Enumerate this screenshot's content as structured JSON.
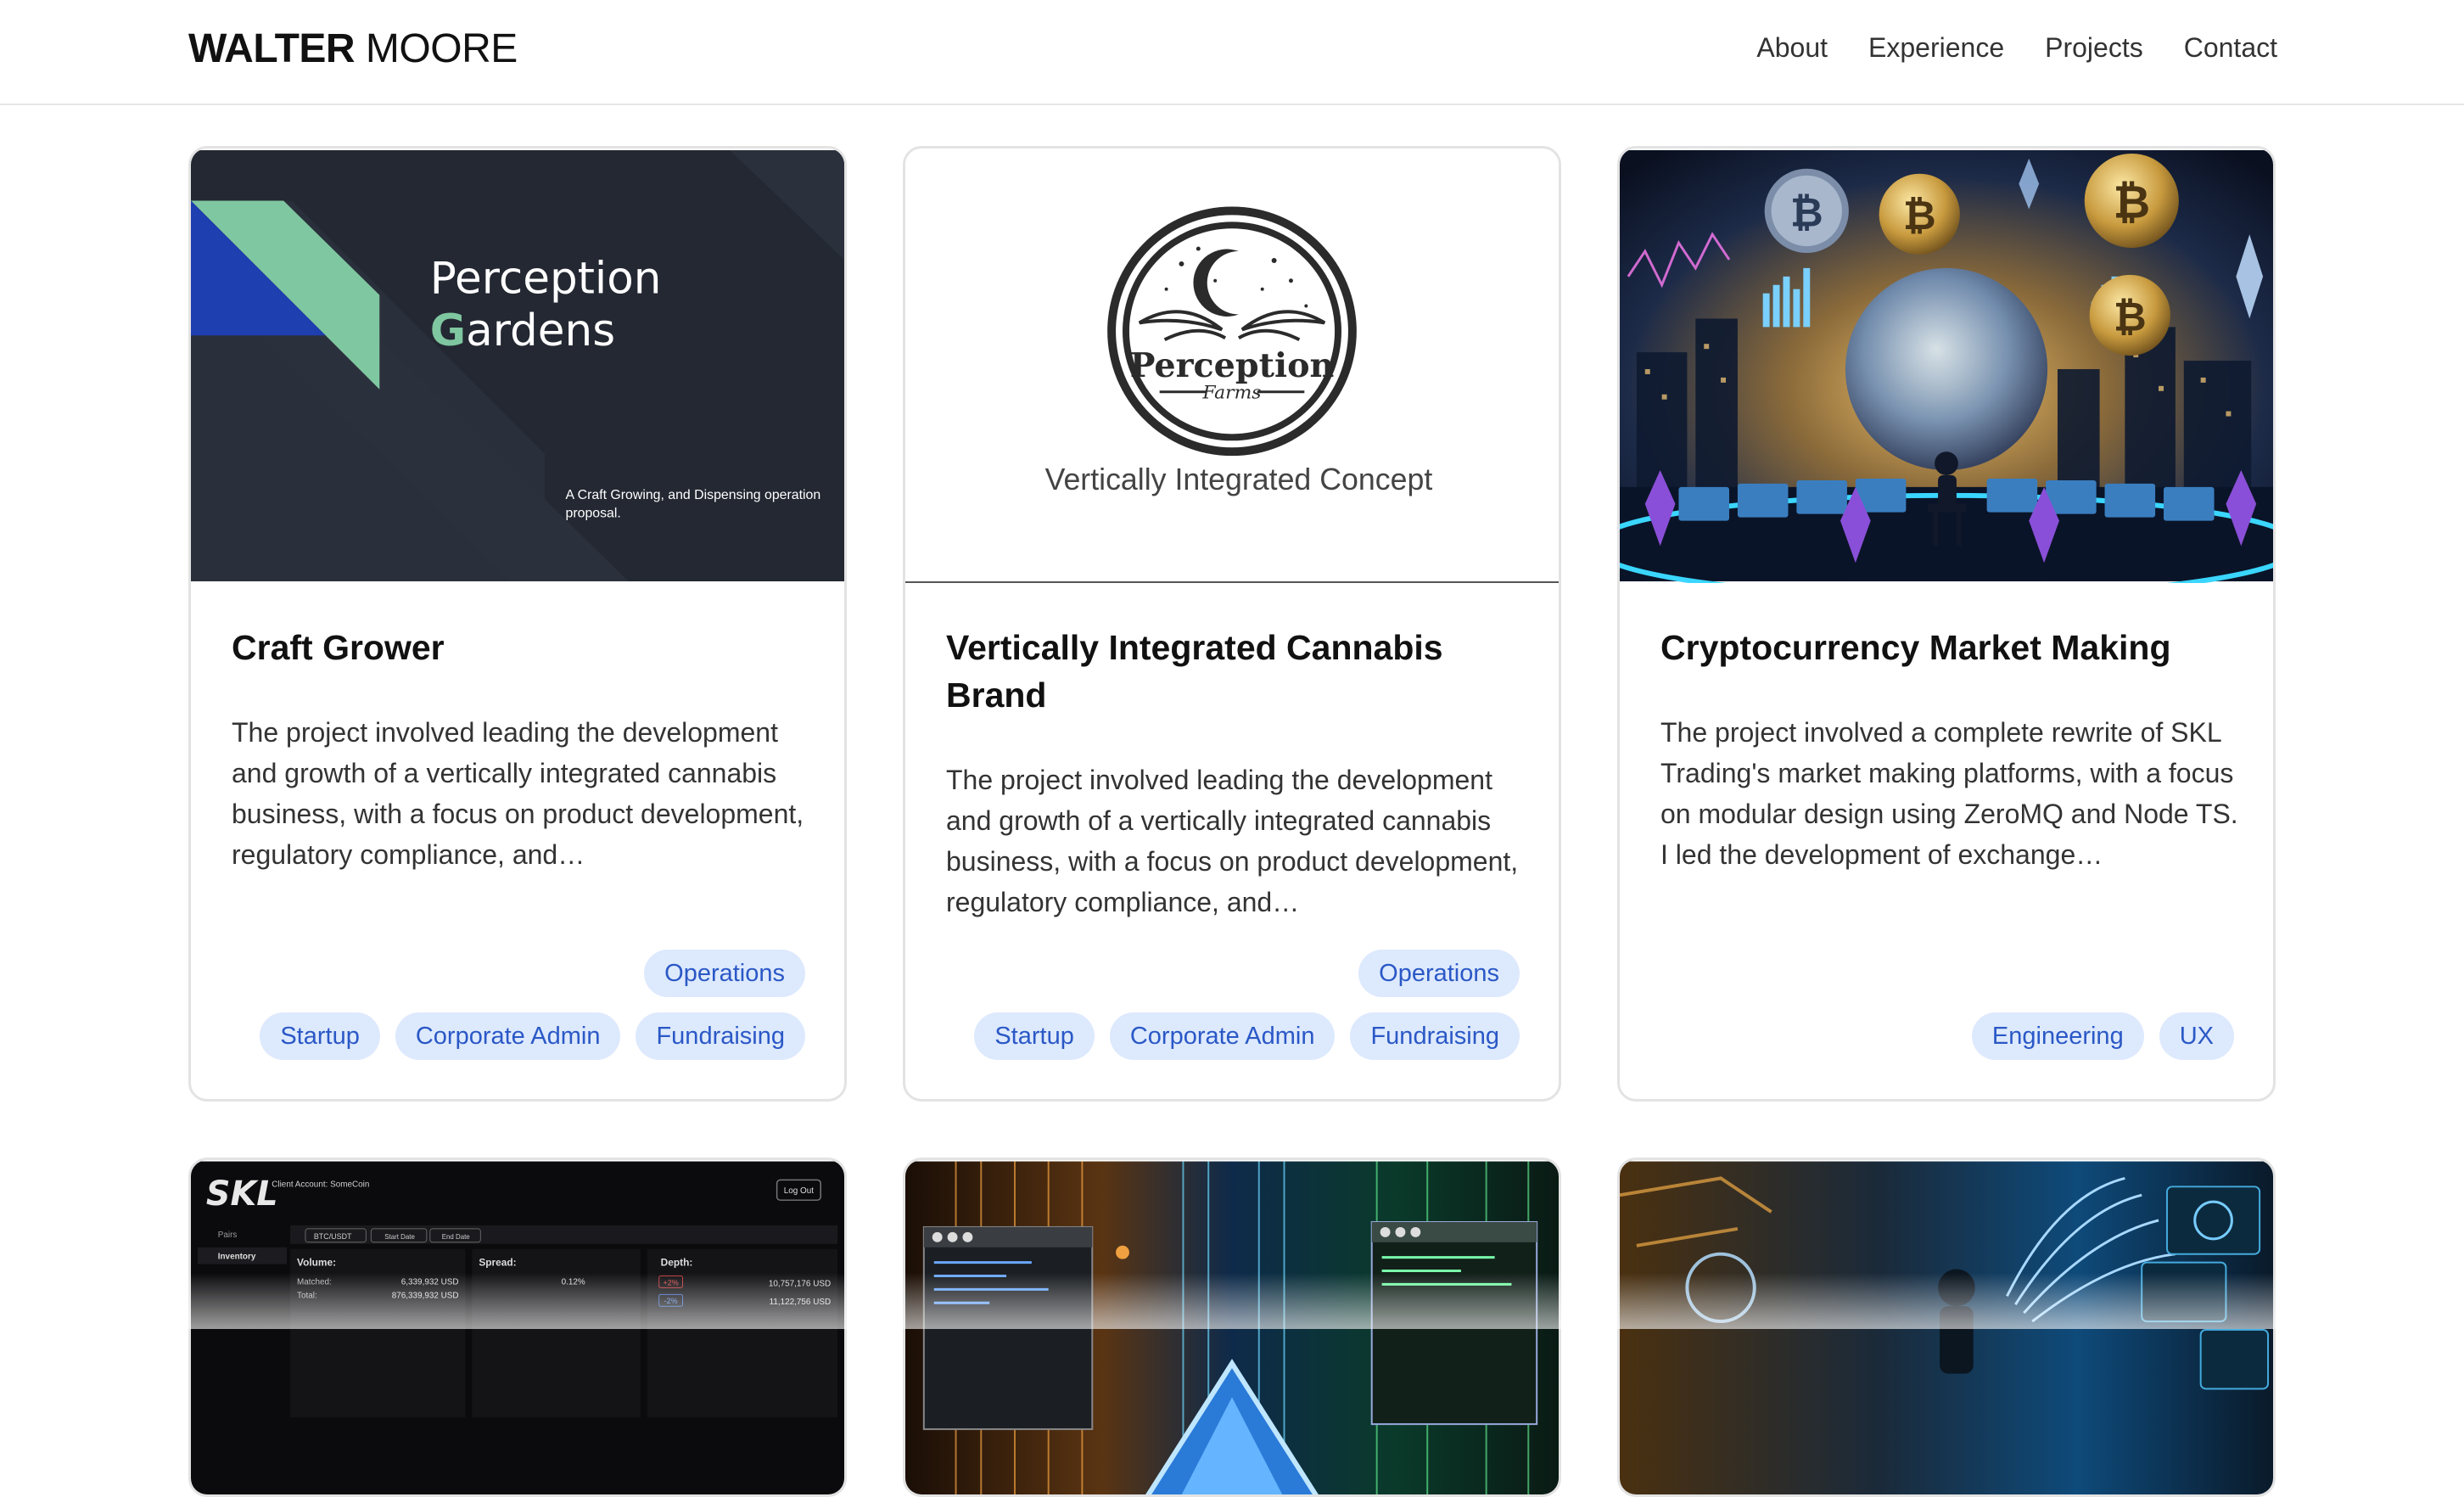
{
  "header": {
    "logo_first": "WALTER",
    "logo_last": "MOORE",
    "nav": [
      "About",
      "Experience",
      "Projects",
      "Contact"
    ]
  },
  "projects": [
    {
      "image": {
        "title_line1": "Perception",
        "title_line2_initial": "G",
        "title_line2_rest": "ardens",
        "caption_line1": "A Craft Growing, and Dispensing operation",
        "caption_line2": "proposal."
      },
      "title": "Craft Grower",
      "description": "The project involved leading the development and growth of a vertically integrated cannabis business, with a focus on product development, regulatory compliance, and…",
      "tags_top": [
        "Operations"
      ],
      "tags_bottom": [
        "Startup",
        "Corporate Admin",
        "Fundraising"
      ]
    },
    {
      "image": {
        "logo_main": "Perception",
        "logo_sub": "Farms",
        "caption": "Vertically Integrated Concept"
      },
      "title": "Vertically Integrated Cannabis Brand",
      "description": "The project involved leading the development and growth of a vertically integrated cannabis business, with a focus on product development, regulatory compliance, and…",
      "tags_top": [
        "Operations"
      ],
      "tags_bottom": [
        "Startup",
        "Corporate Admin",
        "Fundraising"
      ]
    },
    {
      "title": "Cryptocurrency Market Making",
      "description": "The project involved a complete rewrite of SKL Trading's market making platforms, with a focus on modular design using ZeroMQ and Node TS. I led the development of exchange…",
      "tags_top": [],
      "tags_bottom": [
        "Engineering",
        "UX"
      ]
    }
  ],
  "row2": {
    "skl": {
      "logo": "SKL",
      "account": "Client Account: SomeCoin",
      "logout": "Log Out",
      "pairs_label": "Pairs",
      "inventory_label": "Inventory",
      "pair_select": "BTC/USDT",
      "start_date": "Start Date",
      "end_date": "End Date",
      "volume_label": "Volume:",
      "matched_label": "Matched:",
      "matched_value": "6,339,932 USD",
      "total_label": "Total:",
      "total_value": "876,339,932 USD",
      "spread_label": "Spread:",
      "spread_value": "0.12%",
      "depth_label": "Depth:",
      "depth_up_pct": "+2%",
      "depth_up_value": "10,757,176 USD",
      "depth_down_pct": "-2%",
      "depth_down_value": "11,122,756 USD"
    }
  },
  "colors": {
    "tag_bg": "#dde9fd",
    "tag_text": "#2a58c6",
    "slide_bg": "#232832",
    "slide_green": "#7fc7a0",
    "slide_blue": "#1e3fb0"
  }
}
